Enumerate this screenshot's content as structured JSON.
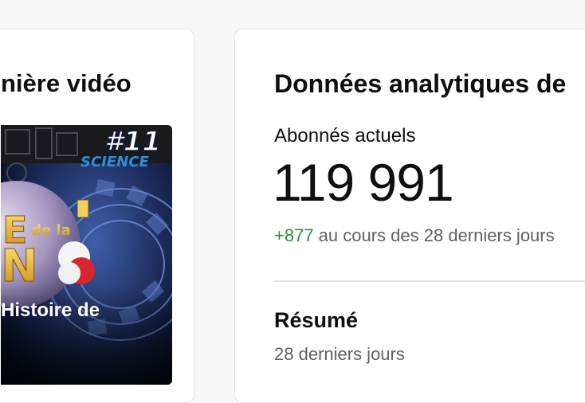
{
  "latest_video": {
    "heading": "nière vidéo",
    "thumbnail": {
      "episode_badge": "#11",
      "category_badge": "SCIENCE",
      "title_overlay": "Histoire de",
      "logo_text_de_la": "de la",
      "logo_letter_e": "E",
      "logo_letter_n": "N"
    }
  },
  "analytics": {
    "heading": "Données analytiques de",
    "subscribers_label": "Abonnés actuels",
    "subscribers_count": "119 991",
    "change_value": "+877",
    "change_text": " au cours des 28 derniers jours",
    "summary_title": "Résumé",
    "summary_period": "28 derniers jours"
  },
  "colors": {
    "page_background": "#f7f7f7",
    "card_background": "#ffffff",
    "positive_change": "#2b9231",
    "secondary_text": "#606060",
    "badge_blue": "#2a8fe0"
  }
}
